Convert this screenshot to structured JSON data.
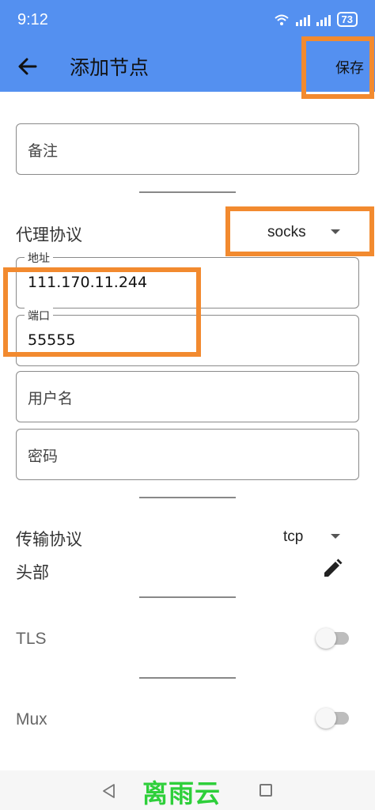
{
  "status_bar": {
    "time": "9:12",
    "battery": "73"
  },
  "header": {
    "title": "添加节点",
    "save_label": "保存"
  },
  "form": {
    "remark_placeholder": "备注",
    "proxy_protocol_label": "代理协议",
    "proxy_protocol_value": "socks",
    "address_label": "地址",
    "address_value": "111.170.11.244",
    "port_label": "端口",
    "port_value": "55555",
    "username_placeholder": "用户名",
    "password_placeholder": "密码",
    "transport_label": "传输协议",
    "transport_value": "tcp",
    "headers_label": "头部",
    "tls_label": "TLS",
    "tls_enabled": false,
    "mux_label": "Mux",
    "mux_enabled": false
  },
  "watermark": "离雨云",
  "colors": {
    "appbar": "#5490f0",
    "highlight": "#f28a2f",
    "watermark": "#2ecf3a"
  },
  "icons": [
    "back-arrow-icon",
    "wifi-icon",
    "signal-icon",
    "battery-icon",
    "edit-pencil-icon",
    "chevron-down-icon",
    "nav-back-icon",
    "nav-home-icon"
  ]
}
